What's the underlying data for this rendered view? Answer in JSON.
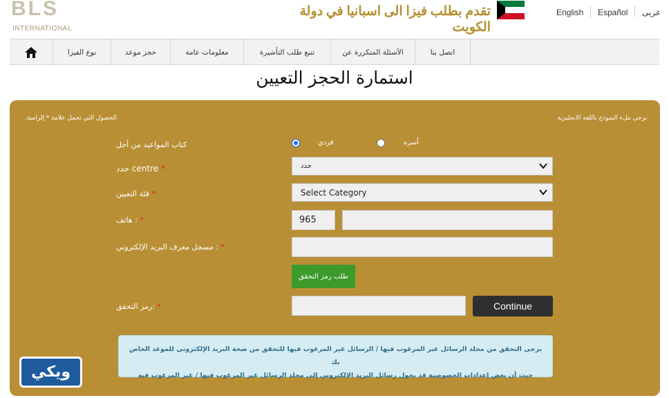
{
  "header": {
    "logo_main": "BLS",
    "logo_sub": "INTERNATIONAL",
    "headline": "تقدم بطلب فيزا الى اسبانيا في دولة الكويت",
    "languages": [
      "English",
      "Español",
      "عربى"
    ]
  },
  "nav": {
    "items": [
      "نوع الفيزا",
      "حجز موعد",
      "معلومات عامة",
      "تتبع طلب التأشيرة",
      "الأسئلة المتكررة عن",
      "اتصل بنا"
    ]
  },
  "page": {
    "title": "استمارة الحجز التعيين"
  },
  "form": {
    "note_left": ".الحصول التي تحمل علامة * إلزامية",
    "note_right": "يرجى ملء النموذج باللغة الانجليزية",
    "booking_for_label": "كتاب المواعيد من أجل",
    "radio_individual": "فردي",
    "radio_family": "أسره",
    "centre_label": "حدد centre",
    "centre_value": "حدد",
    "category_label": "فئة التعيين",
    "category_value": "Select Category",
    "phone_label": "هاتف :",
    "phone_code": "965",
    "email_label": "مسجل معرف البريد الإلكتروني :",
    "request_code_button": "طلب رمز التحقق",
    "verification_label": "رمز التحقق:",
    "continue_button": "Continue",
    "required_mark": "*"
  },
  "info": {
    "line1": "يرجى التحقق من مجلد الرسائل غير المرغوب فيها / الرسائل غير المرغوب فيها للتحقق من صحة البريد الإلكتروني للموعد الخاص بك",
    "line2": "حيث أن بعض إعدادات الخصوصية قد يحول رسائل البريد الإلكتروني إلى مجلد الرسائل غير المرغوب فيها / غير المرغوب فيه"
  },
  "watermark": {
    "text": "ويكي"
  },
  "colors": {
    "panel": "#b98f35",
    "accent_green": "#3c9b2b",
    "required": "#e0251c",
    "headline_gold": "#b58f2f"
  }
}
